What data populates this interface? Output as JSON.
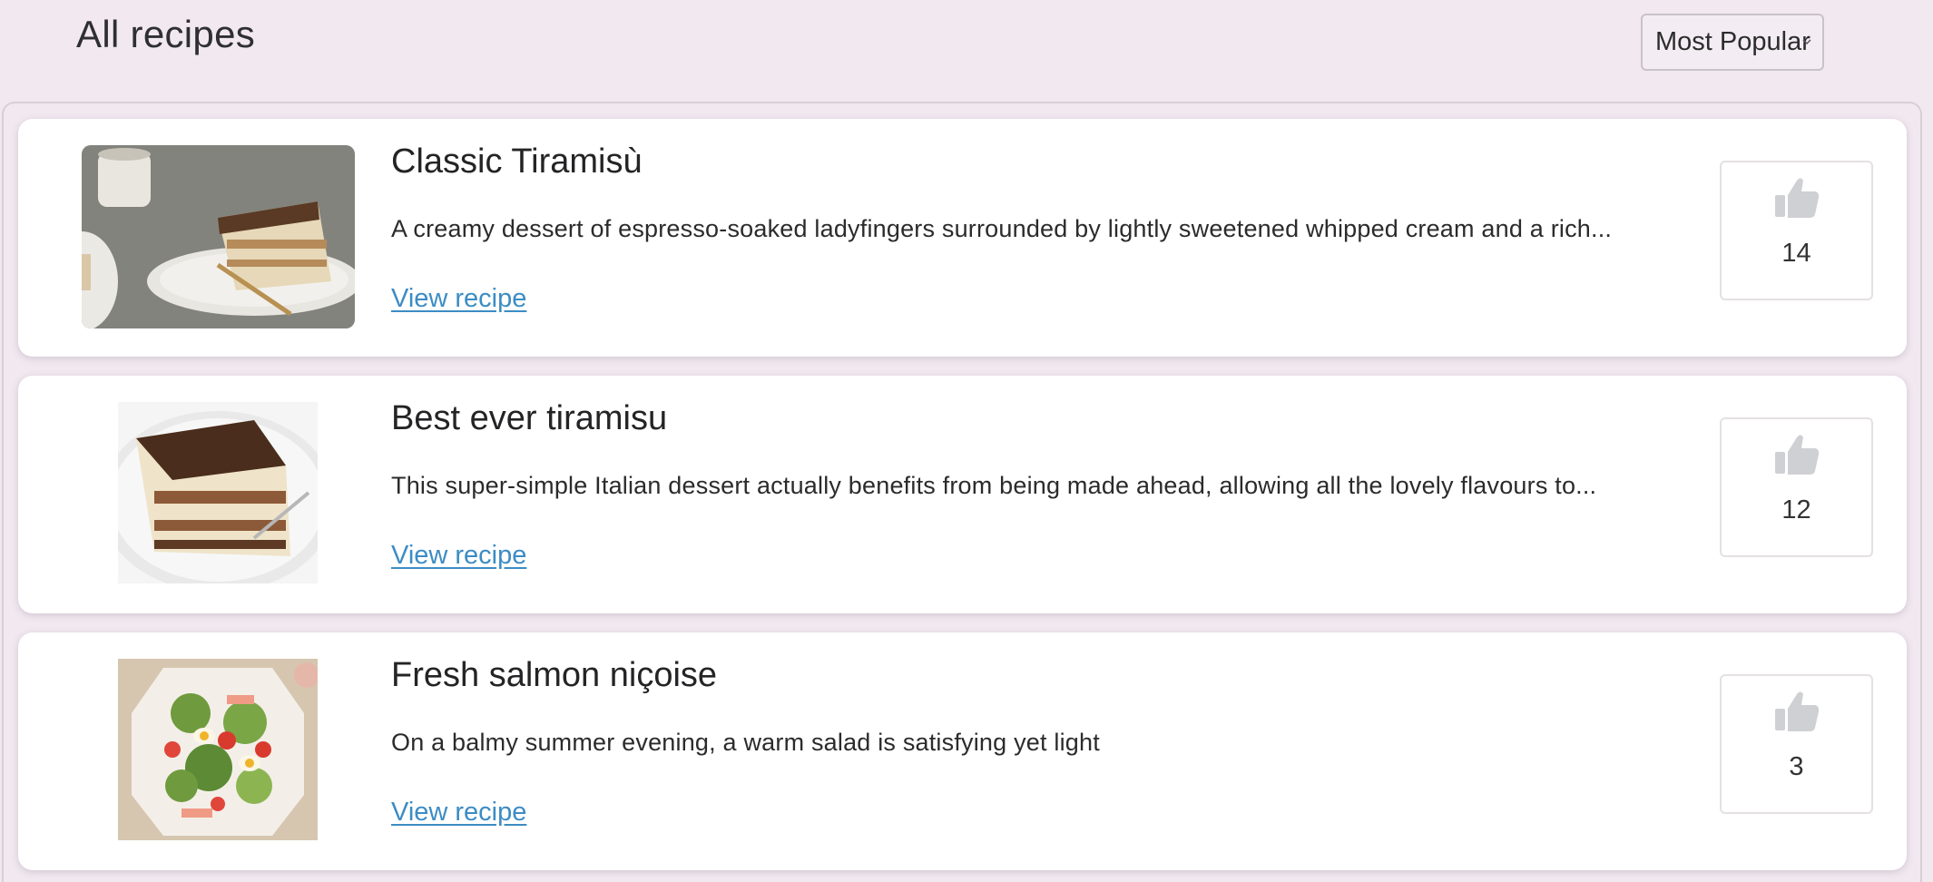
{
  "header": {
    "title": "All recipes",
    "sort": {
      "selected": "Most Popular"
    }
  },
  "recipes": [
    {
      "title": "Classic Tiramisù",
      "description": "A creamy dessert of espresso-soaked ladyfingers surrounded by lightly sweetened whipped cream and a rich...",
      "link_label": "View recipe",
      "likes": "14"
    },
    {
      "title": "Best ever tiramisu",
      "description": "This super-simple Italian dessert actually benefits from being made ahead, allowing all the lovely flavours to...",
      "link_label": "View recipe",
      "likes": "12"
    },
    {
      "title": "Fresh salmon niçoise",
      "description": "On a balmy summer evening, a warm salad is satisfying yet light",
      "link_label": "View recipe",
      "likes": "3"
    }
  ],
  "icons": {
    "like": "thumbs-up-icon",
    "dropdown": "chevron-down-icon"
  },
  "colors": {
    "page_background": "#f1e8f0",
    "card_background": "#ffffff",
    "link": "#3c8cc4",
    "like_icon": "#cfd0d3"
  }
}
